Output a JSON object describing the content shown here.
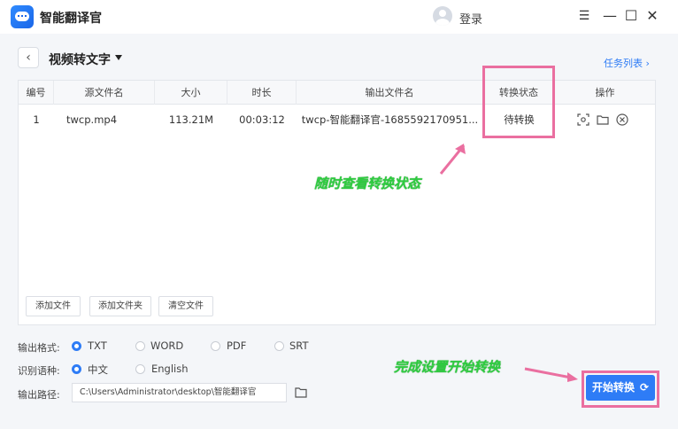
{
  "app": {
    "title": "智能翻译官",
    "login": "登录",
    "win_minimize": "☰",
    "win_min": "—",
    "win_max": "☐",
    "win_close": "✕"
  },
  "header": {
    "back": "‹",
    "page_title": "视频转文字",
    "task_list": "任务列表 ›"
  },
  "table": {
    "columns": [
      "编号",
      "源文件名",
      "大小",
      "时长",
      "输出文件名",
      "转换状态",
      "操作"
    ],
    "rows": [
      {
        "index": "1",
        "source": "twcp.mp4",
        "size": "113.21M",
        "duration": "00:03:12",
        "output": "twcp-智能翻译官-1685592170951...",
        "status": "待转换"
      }
    ]
  },
  "panel_buttons": {
    "add_file": "添加文件",
    "add_folder": "添加文件夹",
    "clear_files": "清空文件"
  },
  "output_format": {
    "label": "输出格式:",
    "options": [
      "TXT",
      "WORD",
      "PDF",
      "SRT"
    ],
    "selected": "TXT"
  },
  "recognize_lang": {
    "label": "识别语种:",
    "options": [
      "中文",
      "English"
    ],
    "selected": "中文"
  },
  "output_path": {
    "label": "输出路径:",
    "value": "C:\\Users\\Administrator\\desktop\\智能翻译官"
  },
  "start_button": {
    "label": "开始转换",
    "icon": "⟳"
  },
  "annotations": {
    "status_note": "随时查看转换状态",
    "start_note": "完成设置开始转换"
  },
  "colors": {
    "accent": "#2e7cf6",
    "highlight": "#ea6fa0",
    "note": "#2ecc40"
  }
}
